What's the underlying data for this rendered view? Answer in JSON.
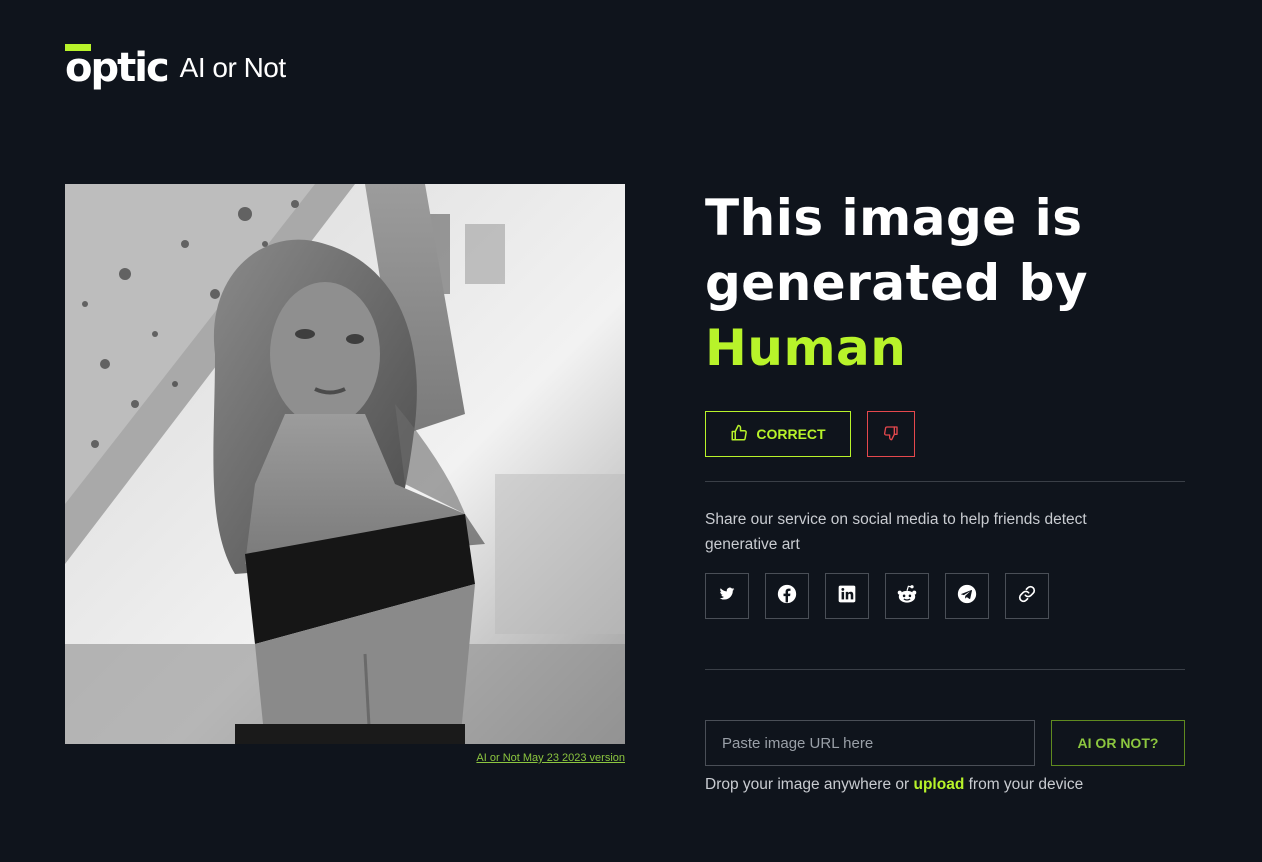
{
  "brand": {
    "logo_text": "optic",
    "product_name": "AI or Not",
    "accent_color": "#b8f32a"
  },
  "result_image": {
    "alt": "Black and white photo of a woman with arm raised against a concrete pillar"
  },
  "caption": {
    "version_link": "AI or Not May 23 2023 version"
  },
  "headline": {
    "line1": "This image is",
    "line2": "generated by",
    "verdict": "Human"
  },
  "feedback": {
    "correct_label": "CORRECT",
    "correct_icon": "thumbs-up-icon",
    "wrong_icon": "thumbs-down-icon",
    "wrong_color": "#e5484d"
  },
  "share": {
    "text": "Share our service on social media to help friends detect generative art",
    "networks": [
      "twitter-icon",
      "facebook-icon",
      "linkedin-icon",
      "reddit-icon",
      "telegram-icon",
      "link-icon"
    ]
  },
  "check": {
    "url_placeholder": "Paste image URL here",
    "button_label": "AI OR NOT?",
    "drop_prefix": "Drop your image anywhere or",
    "upload_label": "upload",
    "drop_suffix": "from your device"
  }
}
